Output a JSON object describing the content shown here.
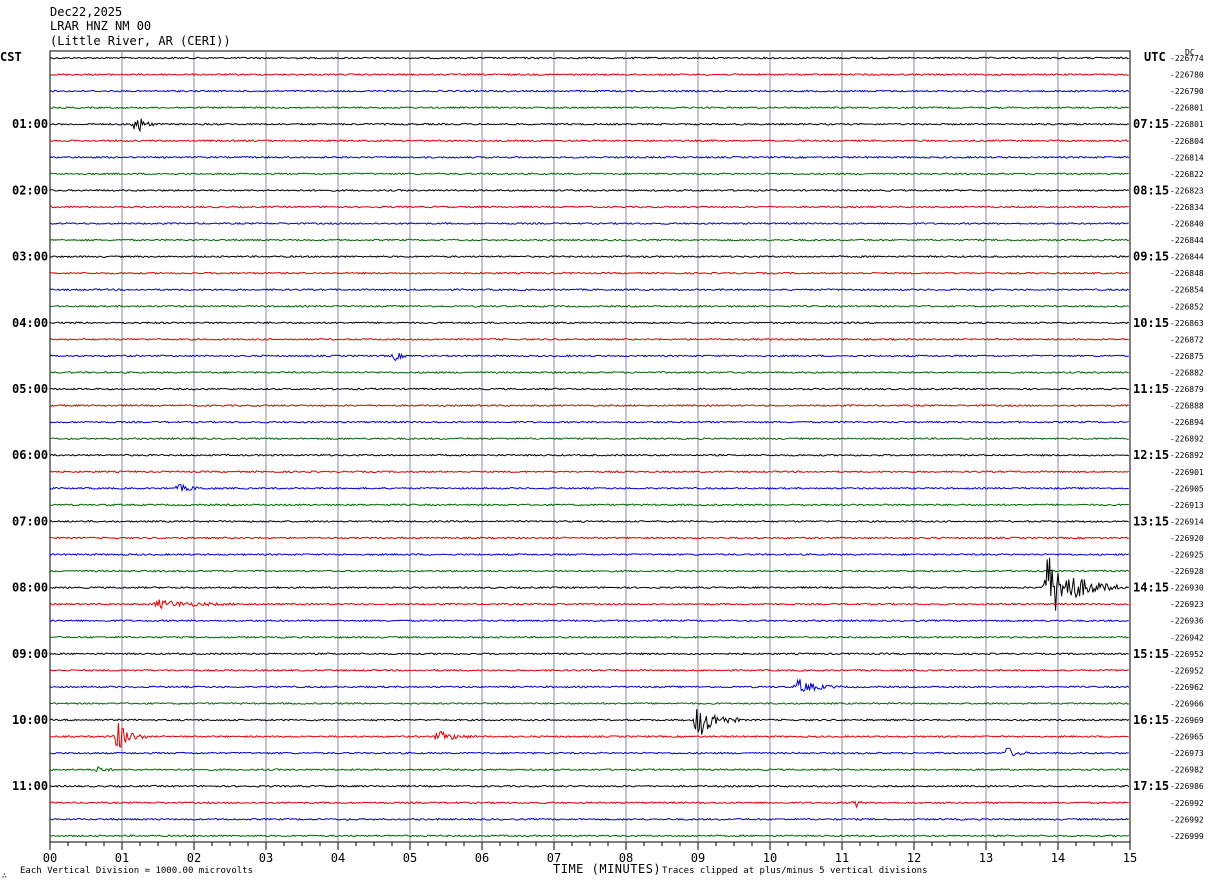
{
  "header": {
    "date": "Dec22,2025",
    "station": "LRAR HNZ NM 00",
    "location": "(Little River, AR (CERI))"
  },
  "left_timezone": "CST",
  "right_timezone": "UTC",
  "dc_label": "DC",
  "footer": {
    "scale_note": "Each Vertical Division = 1000.00 microvolts",
    "clip_note": "Traces clipped at plus/minus 5 vertical divisions",
    "corner_mark": "∴"
  },
  "colors": {
    "trace_cycle": [
      "#000000",
      "#dd0000",
      "#0000cc",
      "#006600"
    ],
    "grid": "#8888aa"
  },
  "chart_data": {
    "type": "line",
    "title": "LRAR HNZ NM 00",
    "xlabel": "TIME (MINUTES)",
    "xlim": [
      0,
      15
    ],
    "x_ticks": [
      "00",
      "01",
      "02",
      "03",
      "04",
      "05",
      "06",
      "07",
      "08",
      "09",
      "10",
      "11",
      "12",
      "13",
      "14",
      "15"
    ],
    "left_hour_labels": [
      "01:00",
      "02:00",
      "03:00",
      "04:00",
      "05:00",
      "06:00",
      "07:00",
      "08:00",
      "09:00",
      "10:00",
      "11:00"
    ],
    "right_hour_labels": [
      "07:15",
      "08:15",
      "09:15",
      "10:15",
      "11:15",
      "12:15",
      "13:15",
      "14:15",
      "15:15",
      "16:15",
      "17:15"
    ],
    "dc_offsets": [
      "-226774",
      "-226780",
      "-226790",
      "-226801",
      "-226801",
      "-226804",
      "-226814",
      "-226822",
      "-226823",
      "-226834",
      "-226840",
      "-226844",
      "-226844",
      "-226848",
      "-226854",
      "-226852",
      "-226863",
      "-226872",
      "-226875",
      "-226882",
      "-226879",
      "-226888",
      "-226894",
      "-226892",
      "-226892",
      "-226901",
      "-226905",
      "-226913",
      "-226914",
      "-226920",
      "-226925",
      "-226928",
      "-226930",
      "-226923",
      "-226936",
      "-226942",
      "-226952",
      "-226952",
      "-226962",
      "-226966",
      "-226969",
      "-226965",
      "-226973",
      "-226982",
      "-226986",
      "-226992",
      "-226992",
      "-226999"
    ],
    "events": [
      {
        "row": 4,
        "minute": 1.2,
        "amplitude": 0.7,
        "duration": 0.25
      },
      {
        "row": 18,
        "minute": 4.8,
        "amplitude": 0.25,
        "duration": 0.2
      },
      {
        "row": 26,
        "minute": 1.8,
        "amplitude": 0.2,
        "duration": 0.5
      },
      {
        "row": 32,
        "minute": 13.85,
        "amplitude": 2.0,
        "duration": 1.0
      },
      {
        "row": 33,
        "minute": 1.5,
        "amplitude": 0.25,
        "duration": 1.2
      },
      {
        "row": 38,
        "minute": 10.4,
        "amplitude": 0.45,
        "duration": 0.6
      },
      {
        "row": 40,
        "minute": 9.0,
        "amplitude": 1.1,
        "duration": 0.6
      },
      {
        "row": 41,
        "minute": 0.95,
        "amplitude": 0.9,
        "duration": 0.4
      },
      {
        "row": 41,
        "minute": 5.4,
        "amplitude": 0.3,
        "duration": 0.6
      },
      {
        "row": 42,
        "minute": 13.3,
        "amplitude": 0.35,
        "duration": 0.3
      },
      {
        "row": 43,
        "minute": 0.7,
        "amplitude": 0.25,
        "duration": 0.2
      },
      {
        "row": 45,
        "minute": 11.2,
        "amplitude": 0.25,
        "duration": 0.1
      }
    ]
  }
}
